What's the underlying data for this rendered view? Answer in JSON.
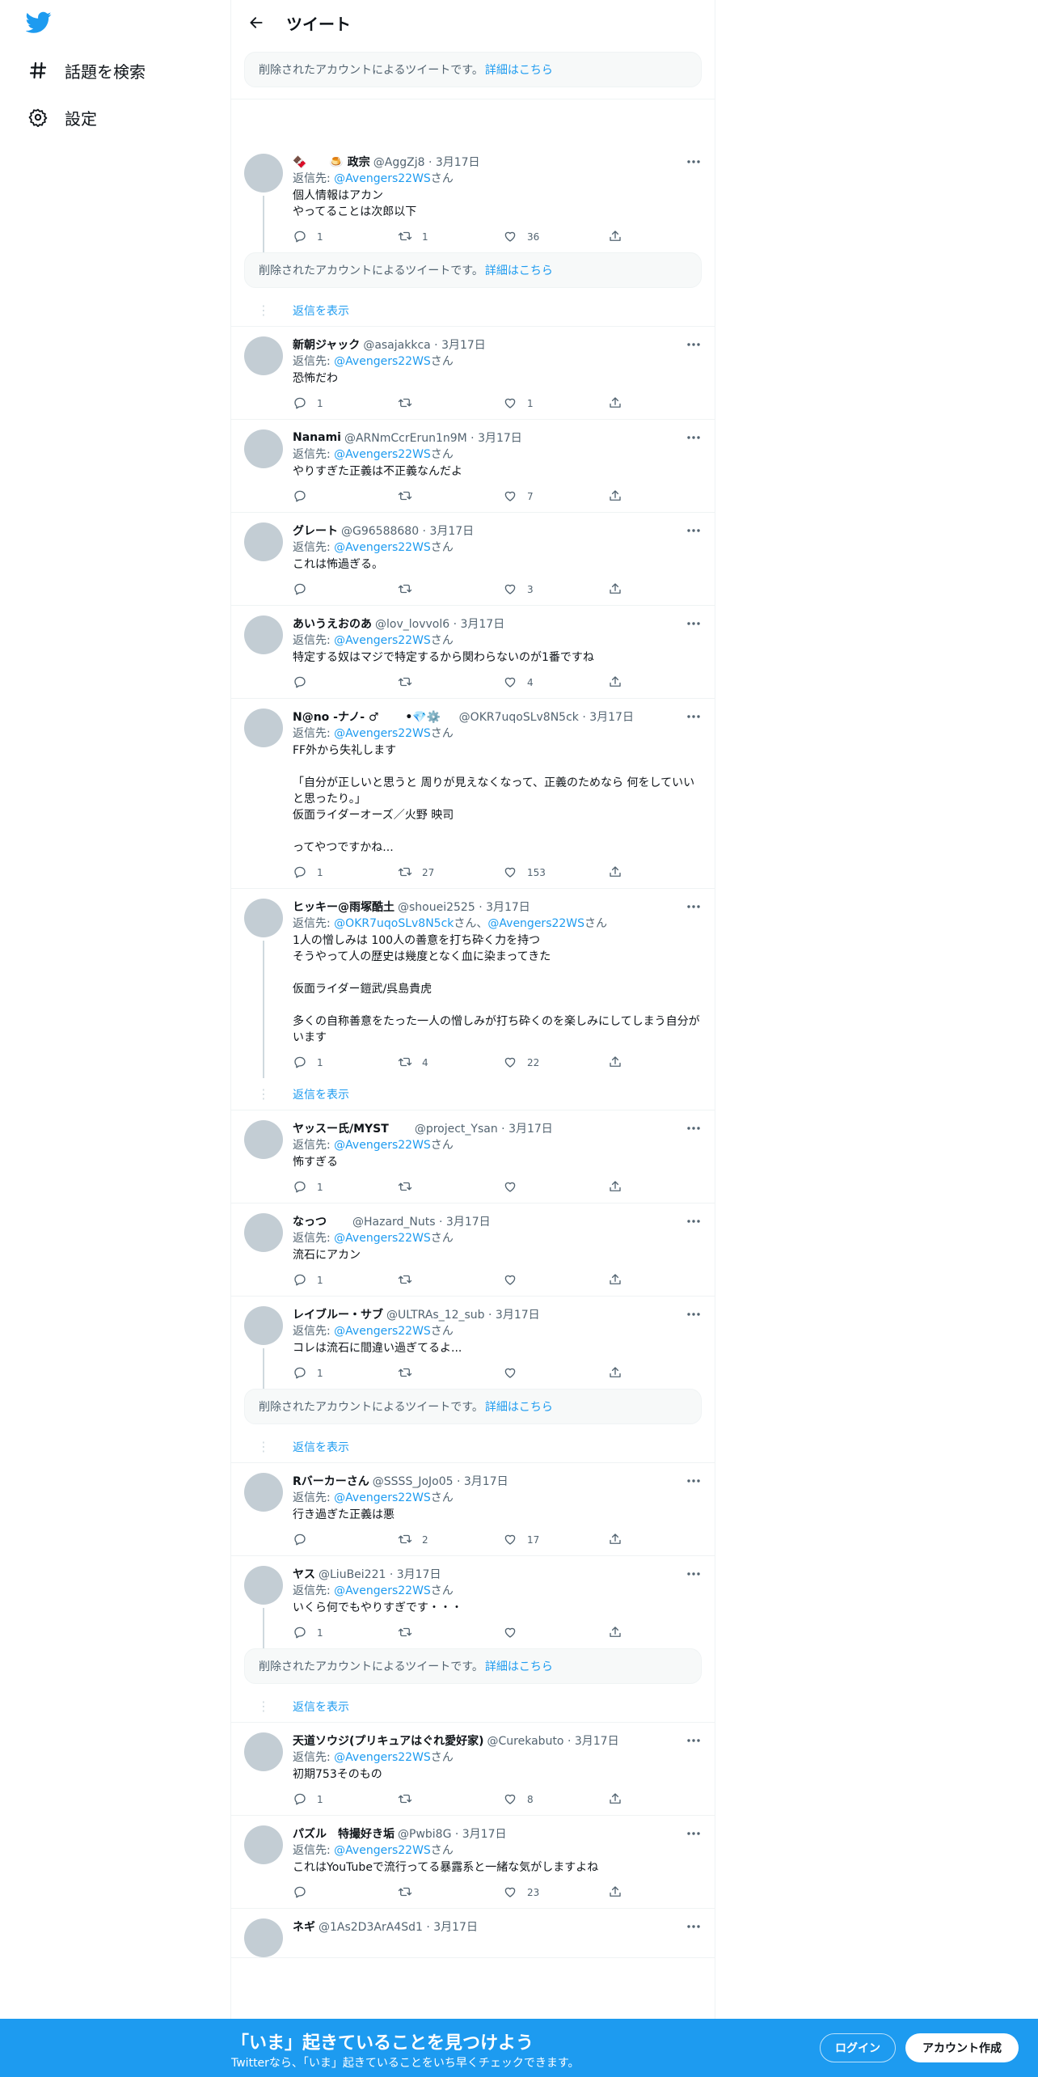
{
  "nav": {
    "explore": "話題を検索",
    "settings": "設定"
  },
  "header": {
    "title": "ツイート"
  },
  "notice": {
    "text": "削除されたアカウントによるツイートです。",
    "link": "詳細はこちら"
  },
  "show_replies": "返信を表示",
  "reply_to_prefix": "返信先: ",
  "reply_to_suffix": "さん",
  "tweets": [
    {
      "name": "🍫　　🍮 政宗",
      "handle": "@AggZj8 · 3月17日",
      "reply_to": "@Avengers22WS",
      "text": "個人情報はアカン\nやってることは次郎以下",
      "replies": "1",
      "retweets": "1",
      "likes": "36"
    },
    {
      "name": "新朝ジャック",
      "handle": "@asajakkca · 3月17日",
      "reply_to": "@Avengers22WS",
      "text": "恐怖だわ",
      "replies": "1",
      "retweets": "",
      "likes": "1"
    },
    {
      "name": "Nanami",
      "handle": "@ARNmCcrErun1n9M · 3月17日",
      "reply_to": "@Avengers22WS",
      "text": "やりすぎた正義は不正義なんだよ",
      "replies": "",
      "retweets": "",
      "likes": "7"
    },
    {
      "name": "グレート",
      "handle": "@G96588680 · 3月17日",
      "reply_to": "@Avengers22WS",
      "text": "これは怖過ぎる。",
      "replies": "",
      "retweets": "",
      "likes": "3"
    },
    {
      "name": "あいうえおのあ",
      "handle": "@lov_lovvol6 · 3月17日",
      "reply_to": "@Avengers22WS",
      "text": "特定する奴はマジで特定するから関わらないのが1番ですね",
      "replies": "",
      "retweets": "",
      "likes": "4"
    },
    {
      "name": "N@no -ナノ- ♂　　 •💎⚙️",
      "handle": "　 @OKR7uqoSLv8N5ck · 3月17日",
      "reply_to": "@Avengers22WS",
      "text": "FF外から失礼します\n\n「自分が正しいと思うと 周りが見えなくなって、正義のためなら 何をしていいと思ったり。」\n仮面ライダーオーズ／火野 映司\n\nってやつですかね...",
      "replies": "1",
      "retweets": "27",
      "likes": "153"
    },
    {
      "name": "ヒッキー@雨塚酷土",
      "handle": "@shouei2525 · 3月17日",
      "reply_to_full": "@OKR7uqoSLv8N5ck",
      "reply_to_sep": "さん、",
      "reply_to": "@Avengers22WS",
      "text": "1人の憎しみは 100人の善意を打ち砕く力を持つ\nそうやって人の歴史は幾度となく血に染まってきた\n\n仮面ライダー鎧武/呉島貴虎\n\n多くの自称善意をたった一人の憎しみが打ち砕くのを楽しみにしてしまう自分がいます",
      "replies": "1",
      "retweets": "4",
      "likes": "22"
    },
    {
      "name": "ヤッスー氏/MYST　　",
      "handle": "@project_Ysan · 3月17日",
      "reply_to": "@Avengers22WS",
      "text": "怖すぎる",
      "replies": "1",
      "retweets": "",
      "likes": ""
    },
    {
      "name": "なっつ　　",
      "handle": "@Hazard_Nuts · 3月17日",
      "reply_to": "@Avengers22WS",
      "text": "流石にアカン",
      "replies": "1",
      "retweets": "",
      "likes": ""
    },
    {
      "name": "レイブルー・サブ",
      "handle": "@ULTRAs_12_sub · 3月17日",
      "reply_to": "@Avengers22WS",
      "text": "コレは流石に間違い過ぎてるよ...",
      "replies": "1",
      "retweets": "",
      "likes": ""
    },
    {
      "name": "Rバーカーさん",
      "handle": "@SSSS_JoJo05 · 3月17日",
      "reply_to": "@Avengers22WS",
      "text": "行き過ぎた正義は悪",
      "replies": "",
      "retweets": "2",
      "likes": "17"
    },
    {
      "name": "ヤス",
      "handle": "@LiuBei221 · 3月17日",
      "reply_to": "@Avengers22WS",
      "text": "いくら何でもやりすぎです・・・",
      "replies": "1",
      "retweets": "",
      "likes": ""
    },
    {
      "name": "天道ソウジ(プリキュアはぐれ愛好家)",
      "handle": "@Curekabuto · 3月17日",
      "reply_to": "@Avengers22WS",
      "text": "初期753そのもの",
      "replies": "1",
      "retweets": "",
      "likes": "8"
    },
    {
      "name": "パズル　特撮好き垢",
      "handle": "@Pwbi8G · 3月17日",
      "reply_to": "@Avengers22WS",
      "text": "これはYouTubeで流行ってる暴露系と一緒な気がしますよね",
      "replies": "",
      "retweets": "",
      "likes": "23"
    },
    {
      "name": "ネギ",
      "handle": "@1As2D3ArA4Sd1 · 3月17日",
      "reply_to": "",
      "text": "",
      "replies": "",
      "retweets": "",
      "likes": ""
    }
  ],
  "bottom_bar": {
    "headline": "「いま」起きていることを見つけよう",
    "sub": "Twitterなら、「いま」起きていることをいち早くチェックできます。",
    "login": "ログイン",
    "signup": "アカウント作成"
  },
  "colors": {
    "accent": "#1d9bf0",
    "muted": "#536471",
    "avatar": "#c3cdd4"
  }
}
